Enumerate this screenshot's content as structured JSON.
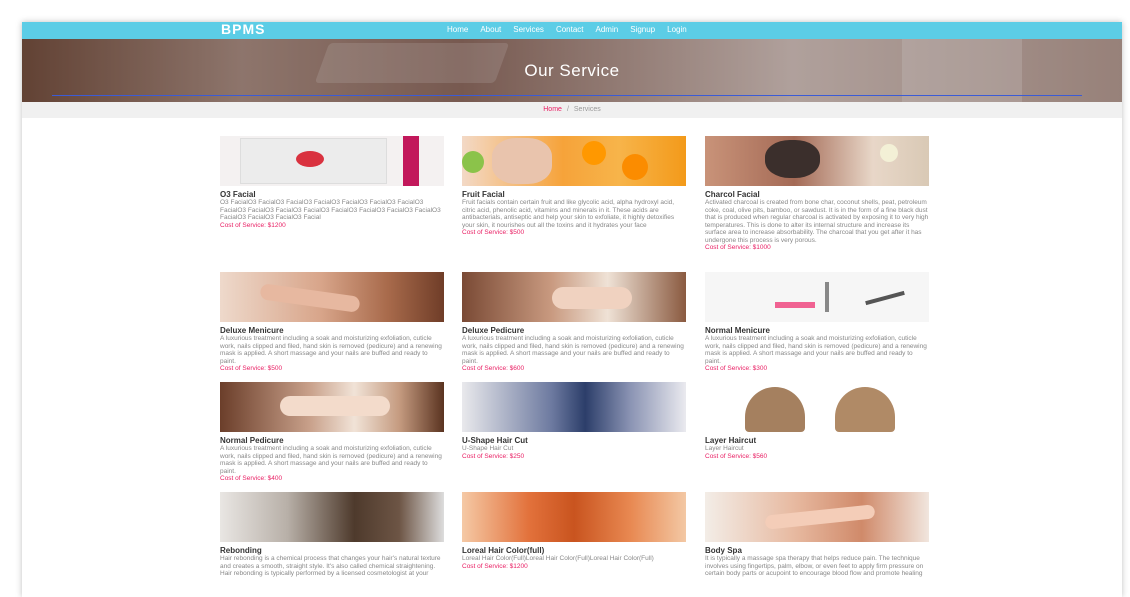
{
  "brand": "BPMS",
  "nav": [
    "Home",
    "About",
    "Services",
    "Contact",
    "Admin",
    "Signup",
    "Login"
  ],
  "hero_title": "Our Service",
  "breadcrumb": {
    "home": "Home",
    "sep": "/",
    "current": "Services"
  },
  "services": [
    {
      "title": "O3 Facial",
      "desc": "O3 FacialO3 FacialO3 FacialO3 FacialO3 FacialO3 FacialO3 FacialO3 FacialO3 FacialO3 FacialO3 FacialO3 FacialO3 FacialO3 FacialO3 FacialO3 FacialO3 FacialO3 FacialO3 Facial",
      "cost": "Cost of Service: $1200",
      "image": "o3-facial-pack"
    },
    {
      "title": "Fruit Facial",
      "desc": "Fruit facials contain certain fruit and like glycolic acid, alpha hydroxyl acid, citric acid, phenolic acid, vitamins and minerals in it. These acids are antibacterials, antiseptic and help your skin to exfoliate, it highly detoxifies your skin, it nourishes out all the toxins and it hydrates your face",
      "cost": "Cost of Service: $500",
      "image": "fruit-facial"
    },
    {
      "title": "Charcol Facial",
      "desc": "Activated charcoal is created from bone char, coconut shells, peat, petroleum coke, coal, olive pits, bamboo, or sawdust. It is in the form of a fine black dust that is produced when regular charcoal is activated by exposing it to very high temperatures. This is done to alter its internal structure and increase its surface area to increase absorbability. The charcoal that you get after it has undergone this process is very porous.",
      "cost": "Cost of Service: $1000",
      "image": "charcoal-facial"
    },
    {
      "title": "Deluxe Menicure",
      "desc": "A luxurious treatment including a soak and moisturizing exfoliation, cuticle work, nails clipped and filed, hand skin is removed (pedicure) and a renewing mask is applied. A short massage and your nails are buffed and ready to paint.",
      "cost": "Cost of Service: $500",
      "image": "manicure-hands"
    },
    {
      "title": "Deluxe Pedicure",
      "desc": "A luxurious treatment including a soak and moisturizing exfoliation, cuticle work, nails clipped and filed, hand skin is removed (pedicure) and a renewing mask is applied. A short massage and your nails are buffed and ready to paint.",
      "cost": "Cost of Service: $600",
      "image": "pedicure-feet"
    },
    {
      "title": "Normal Menicure",
      "desc": "A luxurious treatment including a soak and moisturizing exfoliation, cuticle work, nails clipped and filed, hand skin is removed (pedicure) and a renewing mask is applied. A short massage and your nails are buffed and ready to paint.",
      "cost": "Cost of Service: $300",
      "image": "manicure-tools"
    },
    {
      "title": "Normal Pedicure",
      "desc": "A luxurious treatment including a soak and moisturizing exfoliation, cuticle work, nails clipped and filed, hand skin is removed (pedicure) and a renewing mask is applied. A short massage and your nails are buffed and ready to paint.",
      "cost": "Cost of Service: $400",
      "image": "pedicure-feet-2"
    },
    {
      "title": "U-Shape Hair Cut",
      "desc": "U-Shape Hair Cut",
      "cost": "Cost of Service: $250",
      "image": "u-shape-hair"
    },
    {
      "title": "Layer Haircut",
      "desc": "Layer Haircut",
      "cost": "Cost of Service: $560",
      "image": "layer-haircut"
    },
    {
      "title": "Rebonding",
      "desc": "Hair rebonding is a chemical process that changes your hair's natural texture and creates a smooth, straight style. It's also called chemical straightening. Hair rebonding is typically performed by a licensed cosmetologist at your",
      "cost": "",
      "image": "rebonding-hair"
    },
    {
      "title": "Loreal Hair Color(full)",
      "desc": "Loreal Hair Color(Full)Loreal Hair Color(Full)Loreal Hair Color(Full)",
      "cost": "Cost of Service: $1200",
      "image": "hair-color"
    },
    {
      "title": "Body Spa",
      "desc": "It is typically a massage spa therapy that helps reduce pain. The technique involves using fingertips, palm, elbow, or even feet to apply firm pressure on certain body parts or acupoint to encourage blood flow and promote healing",
      "cost": "",
      "image": "body-spa"
    }
  ],
  "colors": {
    "navbar": "#5ccde6",
    "accent": "#e91e63",
    "hero_line": "#3b5bd6"
  }
}
